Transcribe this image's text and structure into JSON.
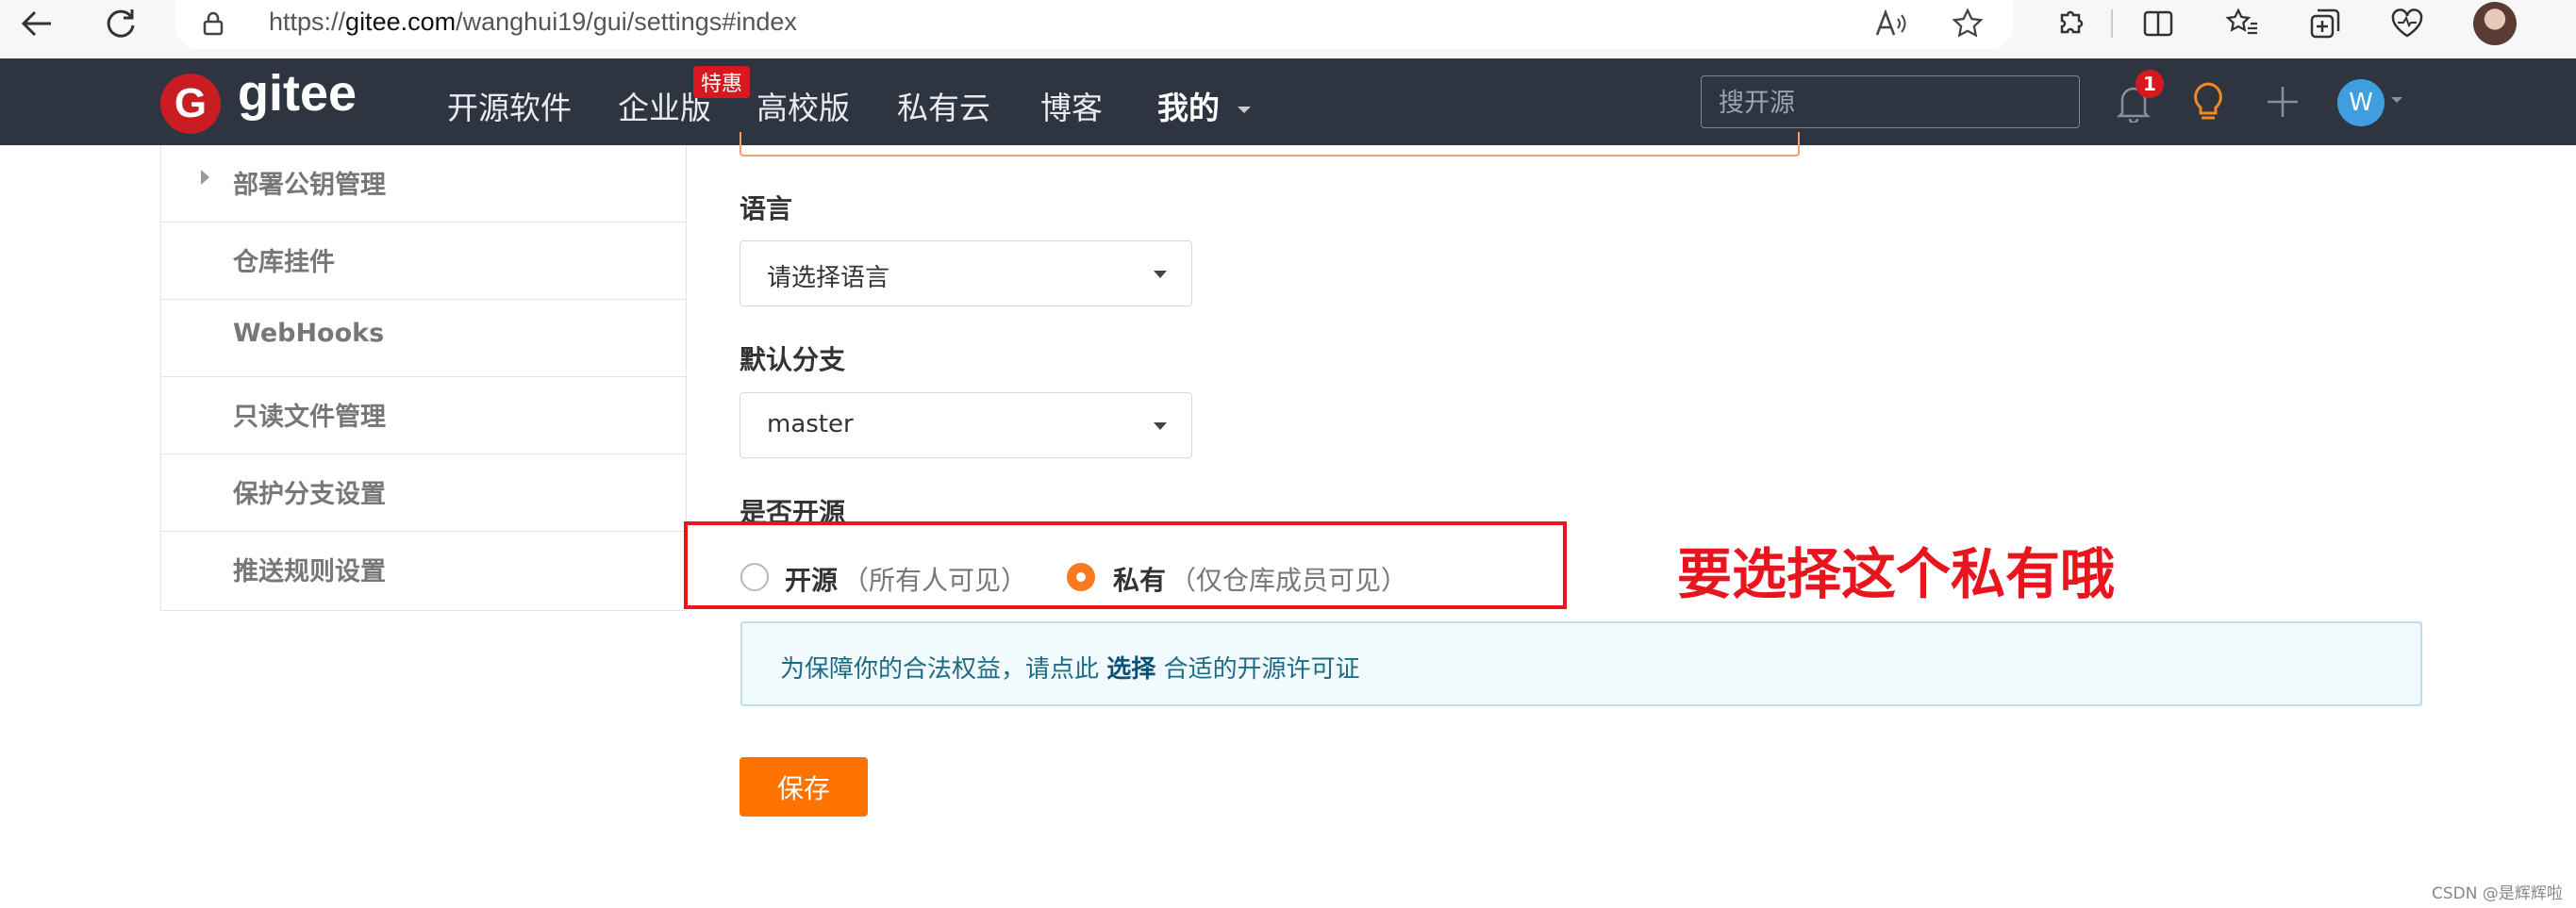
{
  "browser": {
    "url_prefix": "https://",
    "url_domain": "gitee.com",
    "url_path": "/wanghui19/gui/settings#index"
  },
  "nav": {
    "logo_letter": "G",
    "logo_text": "gitee",
    "items": [
      "开源软件",
      "企业版",
      "高校版",
      "私有云",
      "博客"
    ],
    "mine_label": "我的",
    "promo_badge": "特惠",
    "search_placeholder": "搜开源",
    "notification_count": "1",
    "user_initial": "W"
  },
  "sidebar": {
    "items": [
      "部署公钥管理",
      "仓库挂件",
      "WebHooks",
      "只读文件管理",
      "保护分支设置",
      "推送规则设置"
    ]
  },
  "form": {
    "language_label": "语言",
    "language_value": "请选择语言",
    "branch_label": "默认分支",
    "branch_value": "master",
    "open_source_label": "是否开源",
    "option_open": "开源",
    "option_open_hint": "（所有人可见）",
    "option_private": "私有",
    "option_private_hint": "（仅仓库成员可见）",
    "selected_option": "私有",
    "notice_prefix": "为保障你的合法权益，请点此",
    "notice_link": "选择",
    "notice_suffix": "合适的开源许可证",
    "save_label": "保存"
  },
  "annotation": "要选择这个私有哦",
  "watermark": "CSDN @是辉辉啦",
  "colors": {
    "nav_bg": "#2e3440",
    "accent_orange": "#fe7300",
    "annotation_red": "#e8141e",
    "logo_red": "#c71d23"
  },
  "icons": [
    "back-icon",
    "refresh-icon",
    "lock-icon",
    "read-aloud-icon",
    "favorite-star-icon",
    "extensions-icon",
    "split-screen-icon",
    "favorites-icon",
    "collections-icon",
    "health-icon",
    "bell-icon",
    "lightbulb-icon",
    "plus-icon",
    "chevron-down-icon"
  ]
}
